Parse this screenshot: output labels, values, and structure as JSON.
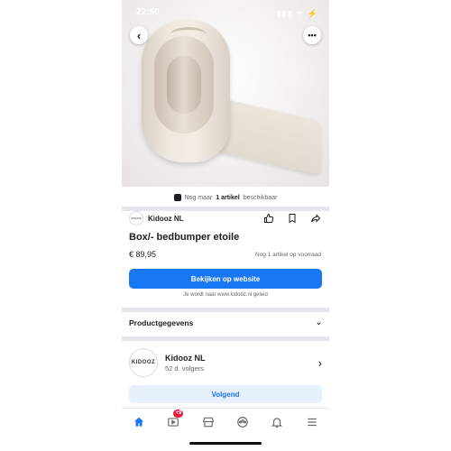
{
  "status_bar": {
    "time": "22:50",
    "icons": "▮▮▮ ᯤ ⚡"
  },
  "nav": {
    "back_icon": "chevron-left-icon",
    "more_icon": "more-icon"
  },
  "availability": {
    "prefix": "Nog maar",
    "bold": "1 artikel",
    "suffix": "beschikbaar"
  },
  "seller": {
    "name": "Kidooz NL",
    "mini_logo": "KIDOOZ"
  },
  "product": {
    "title": "Box/- bedbumper etoile",
    "price": "€ 89,95",
    "stock": "Nog 1 artikel op voorraad"
  },
  "cta": {
    "primary_label": "Bekijken op website",
    "redirect_note": "Je wordt naar www.kidooz.nl geleid"
  },
  "details": {
    "heading": "Productgegevens"
  },
  "shop": {
    "logo": "KIDOOZ",
    "name": "Kidooz NL",
    "followers": "52 d. volgers"
  },
  "follow": {
    "label": "Volgend"
  },
  "tabbar": {
    "video_badge": "+9",
    "items": [
      "home-icon",
      "video-icon",
      "marketplace-icon",
      "groups-icon",
      "notifications-icon",
      "menu-icon"
    ]
  },
  "colors": {
    "accent": "#1877f2",
    "badge": "#e41e3f"
  }
}
